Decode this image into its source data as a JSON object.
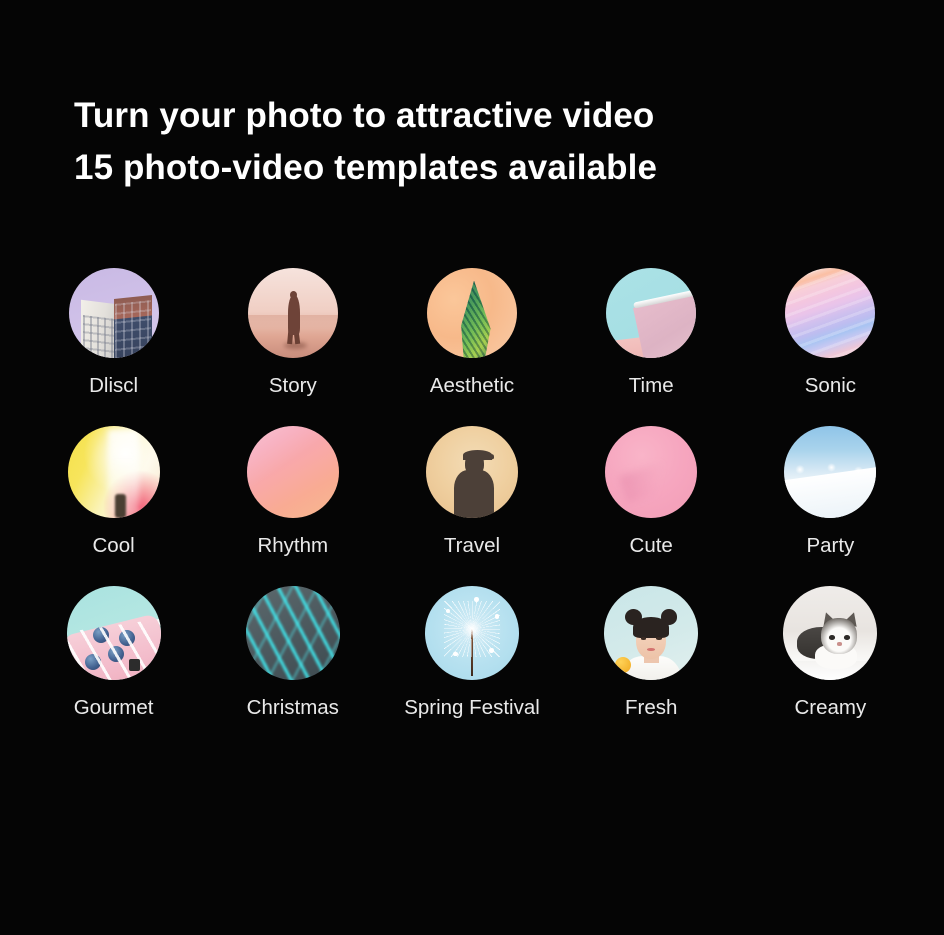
{
  "headline": {
    "line1": "Turn your photo to attractive video",
    "line2": "15 photo-video templates available"
  },
  "theme": {
    "background": "#050505",
    "headline_color": "#ffffff",
    "label_color": "#e9e9e9"
  },
  "templates": [
    {
      "label": "Dliscl",
      "art": "dliscl",
      "thumb_colors": [
        "#c9b9e4",
        "#f2efe9",
        "#3f4d6b",
        "#8e5c52"
      ]
    },
    {
      "label": "Story",
      "art": "story",
      "thumb_colors": [
        "#f6e3dd",
        "#dfa693",
        "#6e4338"
      ]
    },
    {
      "label": "Aesthetic",
      "art": "aesthetic",
      "thumb_colors": [
        "#f7b98a",
        "#2f8a5c",
        "#a9cf4c",
        "#1d5f5e"
      ]
    },
    {
      "label": "Time",
      "art": "time",
      "thumb_colors": [
        "#abe2e6",
        "#e6bccb",
        "#ffffff"
      ]
    },
    {
      "label": "Sonic",
      "art": "sonic",
      "thumb_colors": [
        "#f7c9dd",
        "#fbbfa3",
        "#cfc0ee",
        "#a9c4f2"
      ]
    },
    {
      "label": "Cool",
      "art": "cool",
      "thumb_colors": [
        "#f5e04a",
        "#fdf8e3",
        "#f04664"
      ]
    },
    {
      "label": "Rhythm",
      "art": "rhythm",
      "thumb_colors": [
        "#f6a9c0",
        "#f9ab93",
        "#f7b98f"
      ]
    },
    {
      "label": "Travel",
      "art": "travel",
      "thumb_colors": [
        "#efcf9f",
        "#4c4038"
      ]
    },
    {
      "label": "Cute",
      "art": "cute",
      "thumb_colors": [
        "#f9b4c8",
        "#f29db6"
      ]
    },
    {
      "label": "Party",
      "art": "party",
      "thumb_colors": [
        "#8fc4e8",
        "#ffffff"
      ]
    },
    {
      "label": "Gourmet",
      "art": "gourmet",
      "thumb_colors": [
        "#a9e3e0",
        "#f3bccb",
        "#41608f"
      ]
    },
    {
      "label": "Christmas",
      "art": "christmas",
      "thumb_colors": [
        "#4e5b60",
        "#40e8ee"
      ]
    },
    {
      "label": "Spring Festival",
      "art": "spring",
      "thumb_colors": [
        "#b9e2f0",
        "#ffffff",
        "#3e2a1d"
      ]
    },
    {
      "label": "Fresh",
      "art": "fresh",
      "thumb_colors": [
        "#c9e6e8",
        "#2a2320",
        "#f6d8c3",
        "#f0a81f"
      ]
    },
    {
      "label": "Creamy",
      "art": "creamy",
      "thumb_colors": [
        "#efece9",
        "#35322f",
        "#fbfaf8"
      ]
    }
  ]
}
